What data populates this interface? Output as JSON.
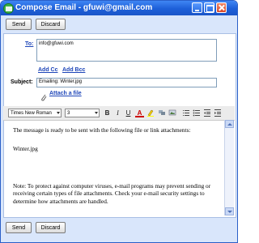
{
  "window": {
    "title": "Compose Email - gfuwi@gmail.com"
  },
  "buttons": {
    "send": "Send",
    "discard": "Discard"
  },
  "to": {
    "label": "To:",
    "value": "info@gfuwi.com"
  },
  "add_cc": "Add Cc",
  "add_bcc": "Add Bcc",
  "subject": {
    "label": "Subject:",
    "value": "Emailing: Winter.jpg"
  },
  "attach": "Attach a file",
  "format": {
    "font": "Times New Roman",
    "size": "3"
  },
  "body": {
    "line1": "The message is ready to be sent with the following file or link attachments:",
    "line2": "Winter.jpg",
    "line3": "Note: To protect against computer viruses, e-mail programs may prevent sending or receiving certain types of file attachments.  Check your e-mail security settings to determine how attachments are handled."
  },
  "colors": {
    "titlebar": "#1d5fd8",
    "background": "#d9e6fb",
    "link": "#1d45b8"
  }
}
